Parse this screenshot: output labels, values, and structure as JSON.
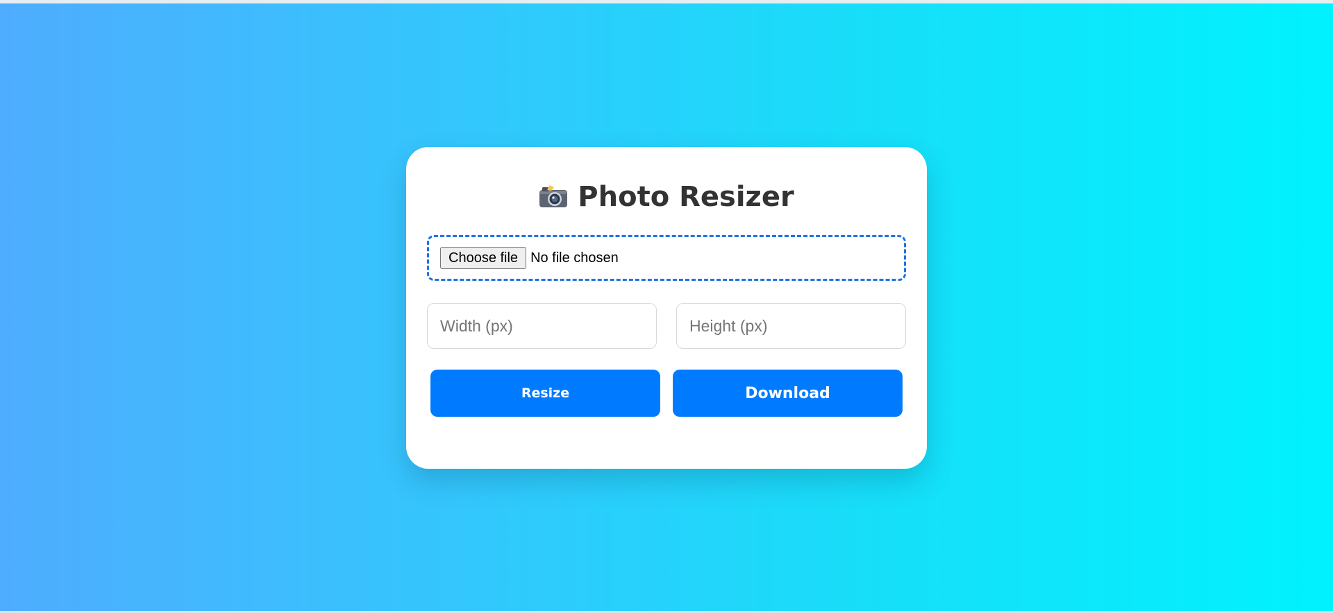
{
  "app": {
    "title": "Photo Resizer",
    "title_icon": "camera-icon"
  },
  "upload": {
    "choose_label": "Choose file",
    "status": "No file chosen",
    "border_color": "#1e74dd"
  },
  "dimensions": {
    "width_value": "",
    "width_placeholder": "Width (px)",
    "height_value": "",
    "height_placeholder": "Height (px)"
  },
  "actions": {
    "resize_label": "Resize",
    "download_label": "Download",
    "button_color": "#007bff"
  },
  "colors": {
    "gradient_start": "#4facfe",
    "gradient_end": "#00f2fe",
    "card_background": "#ffffff",
    "title_color": "#333333"
  }
}
